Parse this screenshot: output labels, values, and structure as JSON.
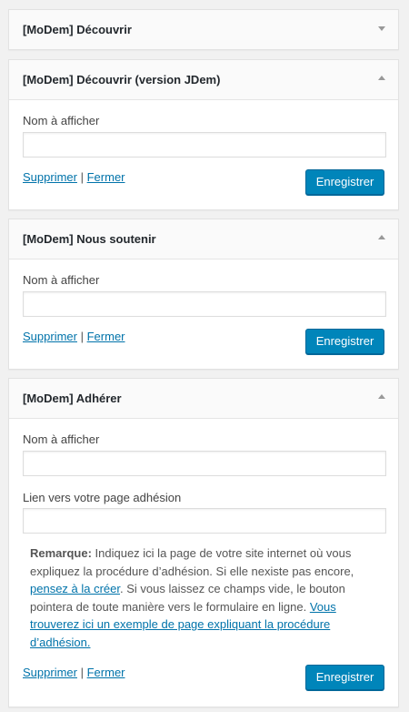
{
  "widgets": [
    {
      "title": "[MoDem] Découvrir",
      "state": "collapsed"
    },
    {
      "title": "[MoDem] Découvrir (version JDem)",
      "state": "open",
      "field_label": "Nom à afficher",
      "field_value": "",
      "delete_label": "Supprimer",
      "separator": "|",
      "close_label": "Fermer",
      "save_label": "Enregistrer"
    },
    {
      "title": "[MoDem] Nous soutenir",
      "state": "open",
      "field_label": "Nom à afficher",
      "field_value": "",
      "delete_label": "Supprimer",
      "separator": "|",
      "close_label": "Fermer",
      "save_label": "Enregistrer"
    },
    {
      "title": "[MoDem] Adhérer",
      "state": "open",
      "field_label": "Nom à afficher",
      "field_value": "",
      "field2_label": "Lien vers votre page adhésion",
      "field2_value": "",
      "remark_label": "Remarque:",
      "remark_text1": " Indiquez ici la page de votre site internet où vous expliquez la procédure d’adhésion. Si elle nexiste pas encore, ",
      "remark_link1": "pensez à la créer",
      "remark_text2": ". Si vous laissez ce champs vide, le bouton pointera de toute manière vers le formulaire en ligne. ",
      "remark_link2": "Vous trouverez ici un exemple de page expliquant la procédure d’adhésion.",
      "delete_label": "Supprimer",
      "separator": "|",
      "close_label": "Fermer",
      "save_label": "Enregistrer"
    }
  ],
  "colors": {
    "accent": "#0085ba",
    "link": "#0073aa",
    "background": "#f1f1f1"
  },
  "icons": {
    "collapsed": "arrow-down-icon",
    "open": "arrow-up-icon"
  }
}
